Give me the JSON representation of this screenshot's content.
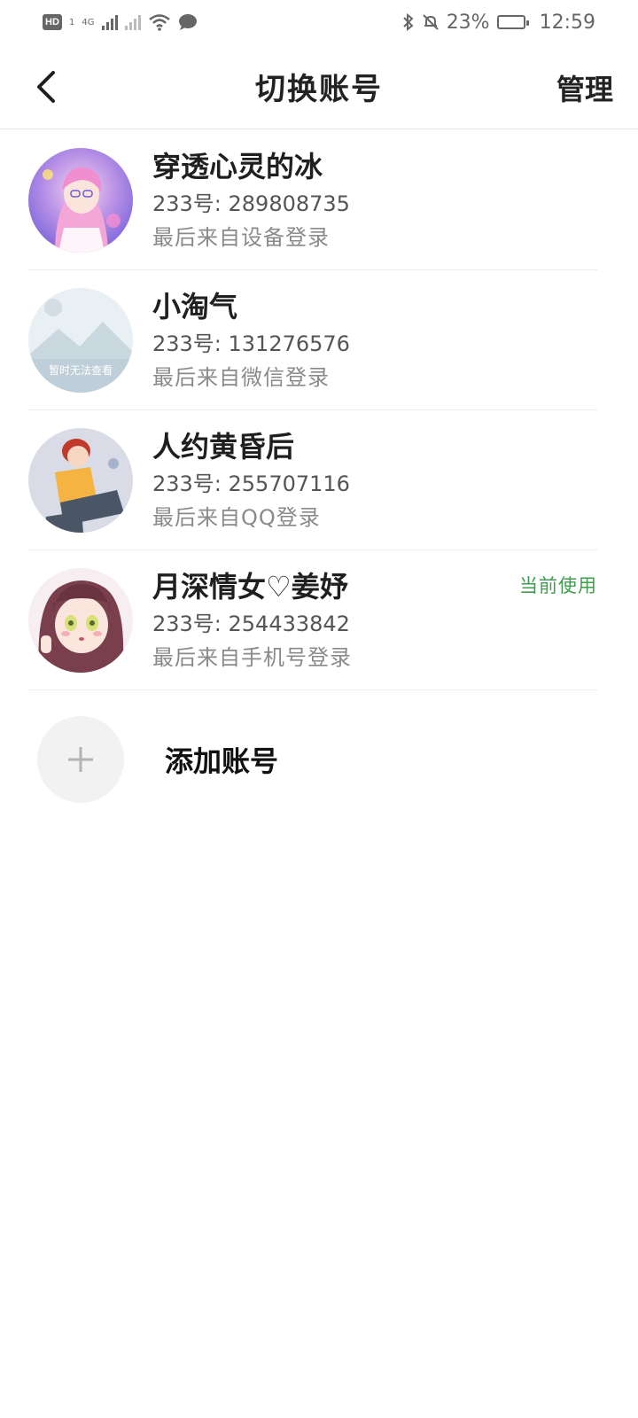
{
  "status_bar": {
    "left_badge": "HD",
    "left_badge_sub": "1",
    "network_label": "4G",
    "battery_percent": "23%",
    "time": "12:59",
    "battery_level": 0.23
  },
  "header": {
    "title": "切换账号",
    "manage_label": "管理"
  },
  "accounts": [
    {
      "name": "穿透心灵的冰",
      "id_line": "233号: 289808735",
      "source": "最后来自设备登录",
      "current_label": ""
    },
    {
      "name": "小淘气",
      "id_line": "233号: 131276576",
      "source": "最后来自微信登录",
      "current_label": "",
      "avatar_placeholder_text": "暂时无法查看"
    },
    {
      "name": "人约黄昏后",
      "id_line": "233号: 255707116",
      "source": "最后来自QQ登录",
      "current_label": ""
    },
    {
      "name": "月深情女♡姜妤",
      "id_line": "233号: 254433842",
      "source": "最后来自手机号登录",
      "current_label": "当前使用"
    }
  ],
  "add_account": {
    "label": "添加账号"
  },
  "colors": {
    "accent_green": "#3f9e4d",
    "divider": "#ececec",
    "text_primary": "#1f1f1f",
    "text_secondary": "#8a8a8a"
  }
}
